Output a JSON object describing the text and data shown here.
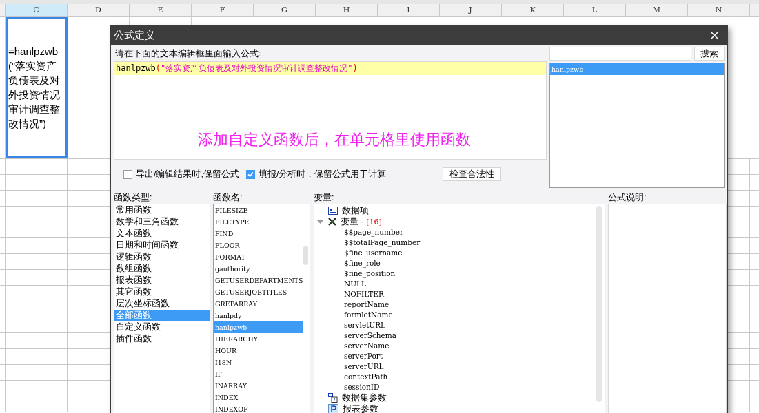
{
  "sheet": {
    "columns": [
      {
        "label": "C",
        "selected": true
      },
      {
        "label": "D",
        "selected": false
      },
      {
        "label": "E",
        "selected": false
      },
      {
        "label": "F",
        "selected": false
      },
      {
        "label": "G",
        "selected": false
      },
      {
        "label": "H",
        "selected": false
      },
      {
        "label": "I",
        "selected": false
      },
      {
        "label": "J",
        "selected": false
      },
      {
        "label": "K",
        "selected": false
      },
      {
        "label": "L",
        "selected": false
      },
      {
        "label": "M",
        "selected": false
      },
      {
        "label": "N",
        "selected": false
      }
    ],
    "active_cell": "=hanlpzwb(”落实资产负债表及对外投资情况审计调查整改情况”)"
  },
  "dialog": {
    "title": "公式定义",
    "editor_label": "请在下面的文本编辑框里面输入公式:",
    "formula": [
      {
        "kind": "name",
        "text": "hanlpzwb"
      },
      {
        "kind": "paren",
        "text": "("
      },
      {
        "kind": "string",
        "text": "\"落实资产负债表及对外投资情况审计调查整改情况\""
      },
      {
        "kind": "paren",
        "text": ")"
      }
    ],
    "annotation": "添加自定义函数后，在单元格里使用函数",
    "options": [
      {
        "label": "导出/编辑结果时,保留公式",
        "checked": false
      },
      {
        "label": "填报/分析时，保留公式用于计算",
        "checked": true
      }
    ],
    "check_button": "检查合法性",
    "search_button": "搜索",
    "search_results": [
      {
        "label": "hanlpzwb",
        "selected": true
      }
    ],
    "types_label": "函数类型:",
    "types": [
      {
        "label": "常用函数",
        "selected": false
      },
      {
        "label": "数学和三角函数",
        "selected": false
      },
      {
        "label": "文本函数",
        "selected": false
      },
      {
        "label": "日期和时间函数",
        "selected": false
      },
      {
        "label": "逻辑函数",
        "selected": false
      },
      {
        "label": "数组函数",
        "selected": false
      },
      {
        "label": "报表函数",
        "selected": false
      },
      {
        "label": "其它函数",
        "selected": false
      },
      {
        "label": "层次坐标函数",
        "selected": false
      },
      {
        "label": "全部函数",
        "selected": true
      },
      {
        "label": "自定义函数",
        "selected": false
      },
      {
        "label": "插件函数",
        "selected": false
      }
    ],
    "names_label": "函数名:",
    "names": [
      {
        "label": "FILESIZE",
        "selected": false
      },
      {
        "label": "FILETYPE",
        "selected": false
      },
      {
        "label": "FIND",
        "selected": false
      },
      {
        "label": "FLOOR",
        "selected": false
      },
      {
        "label": "FORMAT",
        "selected": false
      },
      {
        "label": "gauthority",
        "selected": false
      },
      {
        "label": "GETUSERDEPARTMENTS",
        "selected": false
      },
      {
        "label": "GETUSERJOBTITLES",
        "selected": false
      },
      {
        "label": "GREPARRAY",
        "selected": false
      },
      {
        "label": "hanlpdy",
        "selected": false
      },
      {
        "label": "hanlpzwb",
        "selected": true
      },
      {
        "label": "HIERARCHY",
        "selected": false
      },
      {
        "label": "HOUR",
        "selected": false
      },
      {
        "label": "I18N",
        "selected": false
      },
      {
        "label": "IF",
        "selected": false
      },
      {
        "label": "INARRAY",
        "selected": false
      },
      {
        "label": "INDEX",
        "selected": false
      },
      {
        "label": "INDEXOF",
        "selected": false
      }
    ],
    "variables_label": "变量:",
    "variables": [
      {
        "kind": "data-item",
        "label": "数据项"
      },
      {
        "kind": "variable",
        "label": "变量 -",
        "count": "[16]",
        "expanded": true,
        "children": [
          {
            "label": "$$page_number"
          },
          {
            "label": "$$totalPage_number"
          },
          {
            "label": "$fine_username"
          },
          {
            "label": "$fine_role"
          },
          {
            "label": "$fine_position"
          },
          {
            "label": "NULL"
          },
          {
            "label": "NOFILTER"
          },
          {
            "label": "reportName"
          },
          {
            "label": "formletName"
          },
          {
            "label": "servletURL"
          },
          {
            "label": "serverSchema"
          },
          {
            "label": "serverName"
          },
          {
            "label": "serverPort"
          },
          {
            "label": "serverURL"
          },
          {
            "label": "contextPath"
          },
          {
            "label": "sessionID"
          }
        ]
      },
      {
        "kind": "dataset-param",
        "label": "数据集参数"
      },
      {
        "kind": "report-param",
        "label": "报表参数"
      }
    ],
    "description_label": "公式说明:"
  }
}
